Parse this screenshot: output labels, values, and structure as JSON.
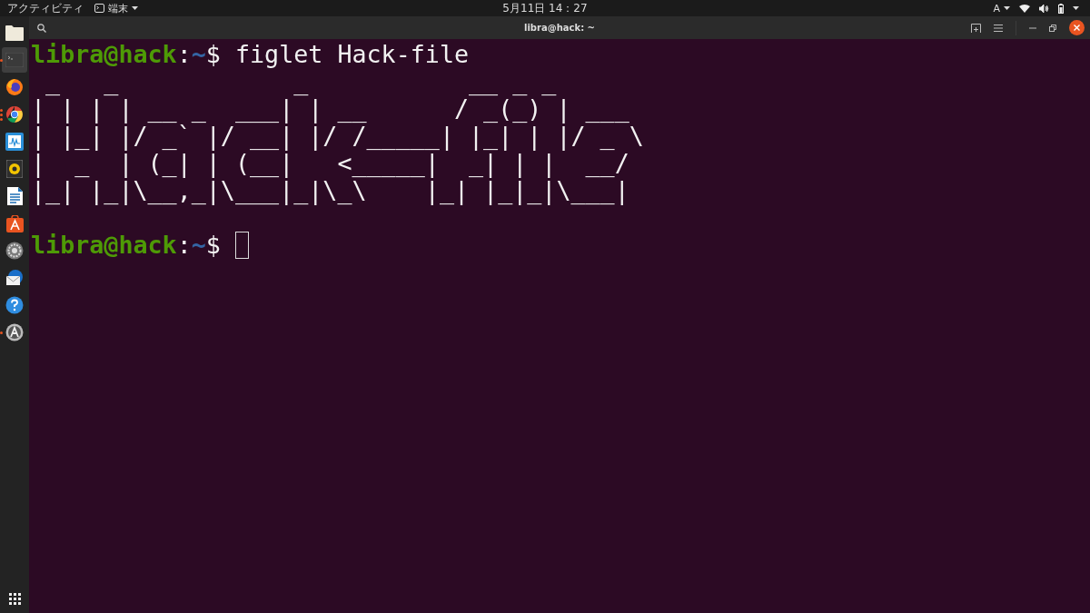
{
  "top_bar": {
    "activities": "アクティビティ",
    "app_menu": "端末",
    "clock": "5月11日  14：27",
    "input_method": "A"
  },
  "dock": [
    {
      "kind": "folder",
      "selected": false,
      "running": false,
      "multiple_windows": false
    },
    {
      "kind": "terminal",
      "selected": true,
      "running": true,
      "multiple_windows": false
    },
    {
      "kind": "firefox",
      "selected": false,
      "running": false,
      "multiple_windows": false
    },
    {
      "kind": "chrome",
      "selected": false,
      "running": true,
      "multiple_windows": true
    },
    {
      "kind": "monitor",
      "selected": false,
      "running": false,
      "multiple_windows": false
    },
    {
      "kind": "speaker",
      "selected": false,
      "running": false,
      "multiple_windows": false
    },
    {
      "kind": "document",
      "selected": false,
      "running": false,
      "multiple_windows": false
    },
    {
      "kind": "store",
      "selected": false,
      "running": false,
      "multiple_windows": false
    },
    {
      "kind": "settings",
      "selected": false,
      "running": false,
      "multiple_windows": false
    },
    {
      "kind": "mail",
      "selected": false,
      "running": false,
      "multiple_windows": false
    },
    {
      "kind": "help",
      "selected": false,
      "running": false,
      "multiple_windows": false
    },
    {
      "kind": "updater",
      "selected": false,
      "running": true,
      "multiple_windows": false
    }
  ],
  "window": {
    "title": "libra@hack: ~"
  },
  "terminal": {
    "lines": [
      {
        "kind": "prompt",
        "user_host": "libra@hack",
        "separator": ":",
        "path": "~",
        "symbol": "$",
        "command": "figlet Hack-file",
        "cursor": false
      },
      {
        "kind": "output",
        "text": " _   _            _           __ _ _"
      },
      {
        "kind": "output",
        "text": "| | | | __ _  ___| | __      / _(_) | ___"
      },
      {
        "kind": "output",
        "text": "| |_| |/ _` |/ __| |/ /_____| |_| | |/ _ \\"
      },
      {
        "kind": "output",
        "text": "|  _  | (_| | (__|   <_____|  _| | |  __/"
      },
      {
        "kind": "output",
        "text": "|_| |_|\\__,_|\\___|_|\\_\\    |_| |_|_|\\___|"
      },
      {
        "kind": "blank"
      },
      {
        "kind": "prompt",
        "user_host": "libra@hack",
        "separator": ":",
        "path": "~",
        "symbol": "$",
        "cursor": true
      }
    ]
  }
}
